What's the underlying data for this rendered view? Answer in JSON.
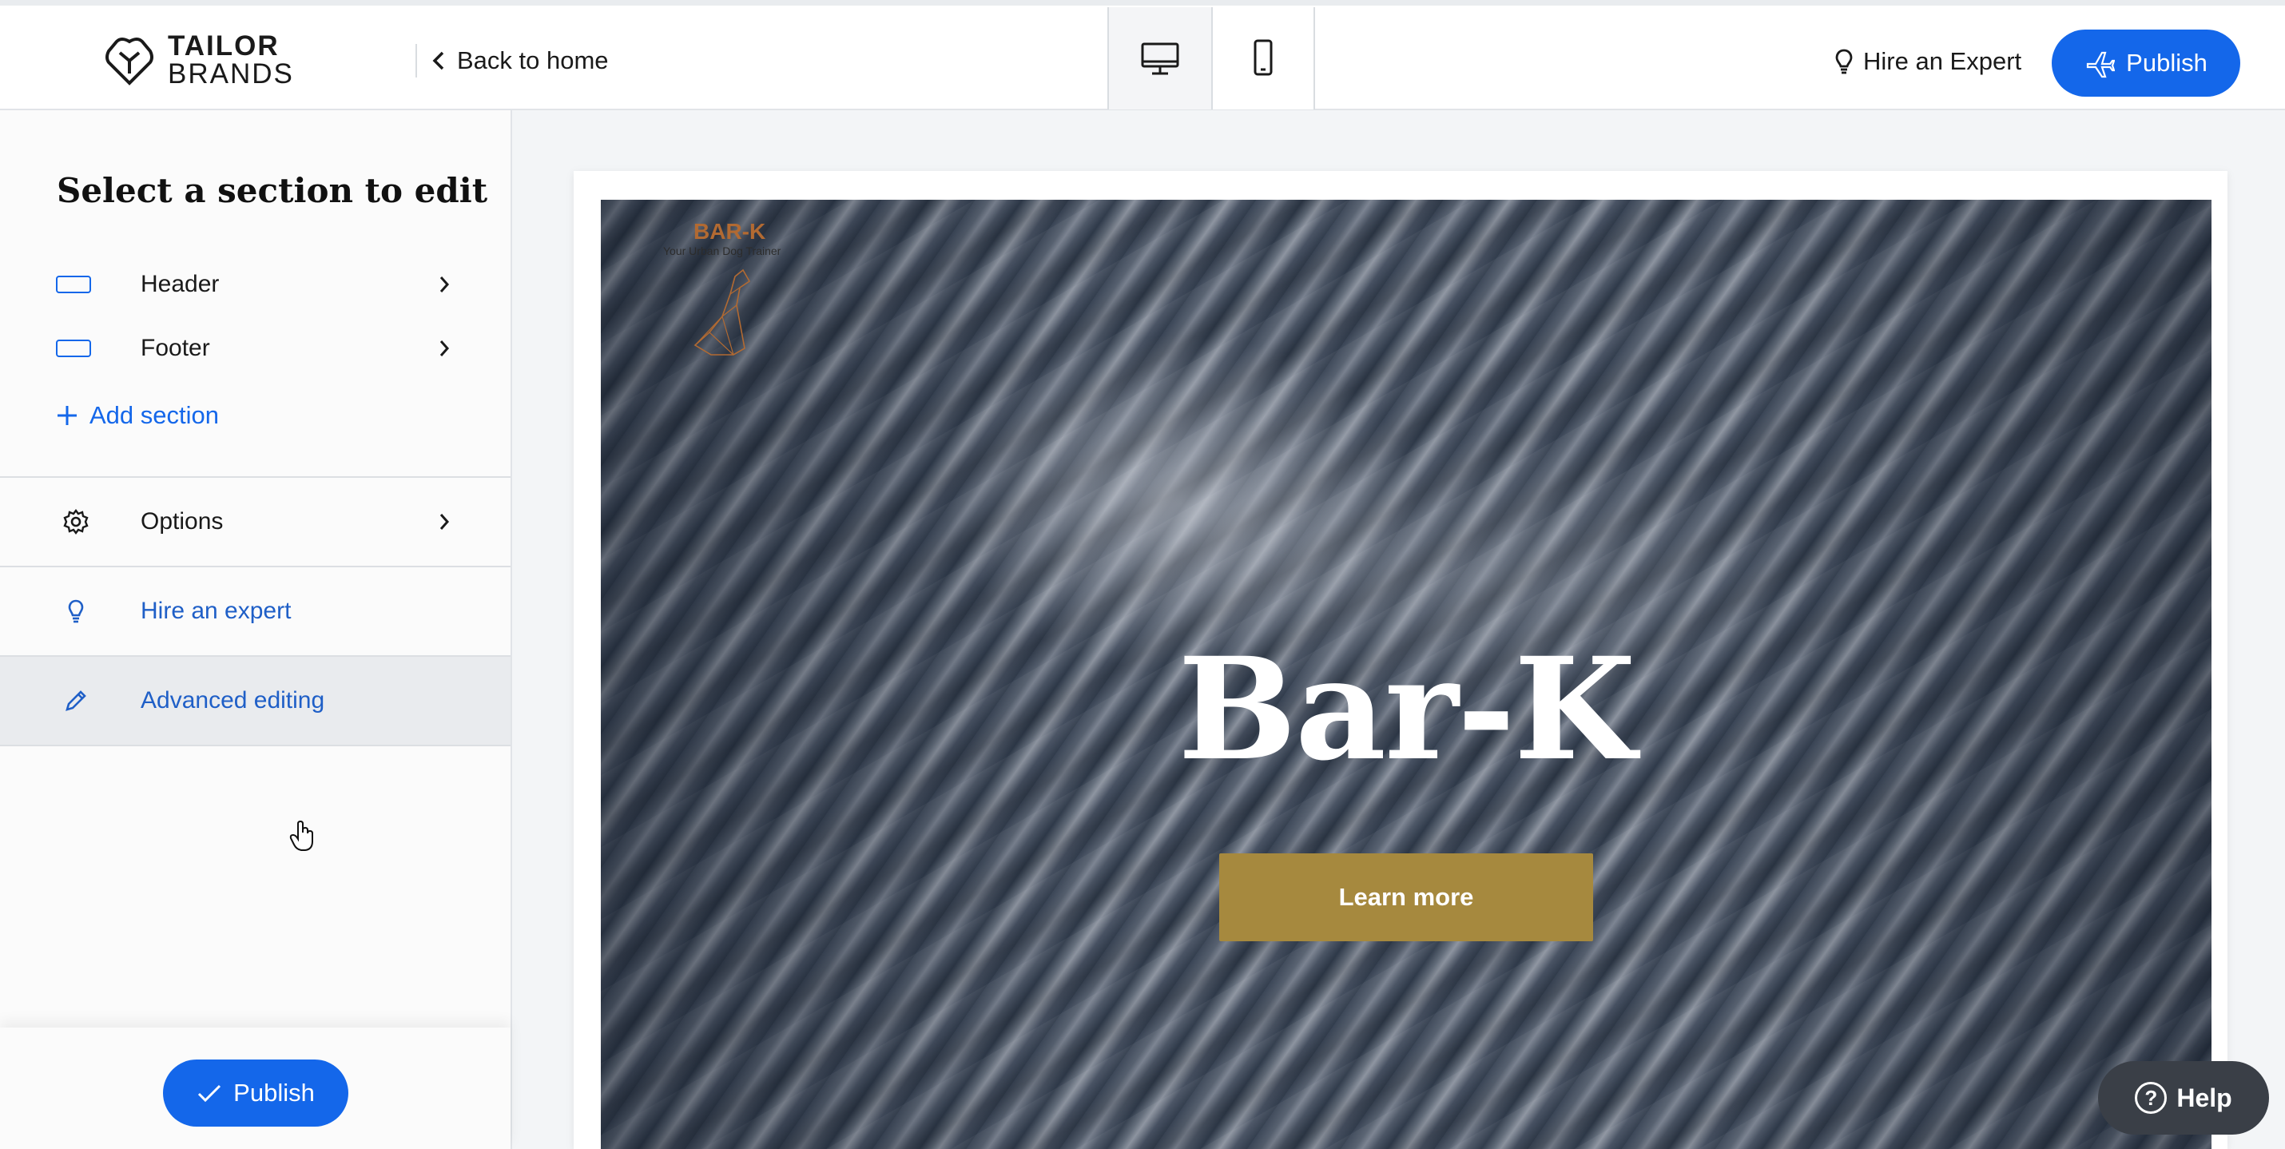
{
  "topbar": {
    "logo_line1": "TAILOR",
    "logo_line2": "BRANDS",
    "back_label": "Back to home",
    "device_desktop": "desktop-icon",
    "device_mobile": "mobile-icon",
    "hire_label": "Hire an Expert",
    "publish_label": "Publish"
  },
  "sidebar": {
    "title": "Select a section to edit",
    "sections": [
      {
        "label": "Header"
      },
      {
        "label": "Footer"
      }
    ],
    "add_section": "Add section",
    "options_label": "Options",
    "hire_label": "Hire an expert",
    "advanced_label": "Advanced editing",
    "publish_label": "Publish"
  },
  "site": {
    "logo_name": "BAR-K",
    "logo_tagline": "Your Urban Dog Trainer",
    "hero_title": "Bar-K",
    "hero_button": "Learn more"
  },
  "help": {
    "label": "Help"
  },
  "colors": {
    "accent_blue": "#1467ea",
    "hero_button": "#a6893e",
    "logo_orange": "#b26a32"
  }
}
